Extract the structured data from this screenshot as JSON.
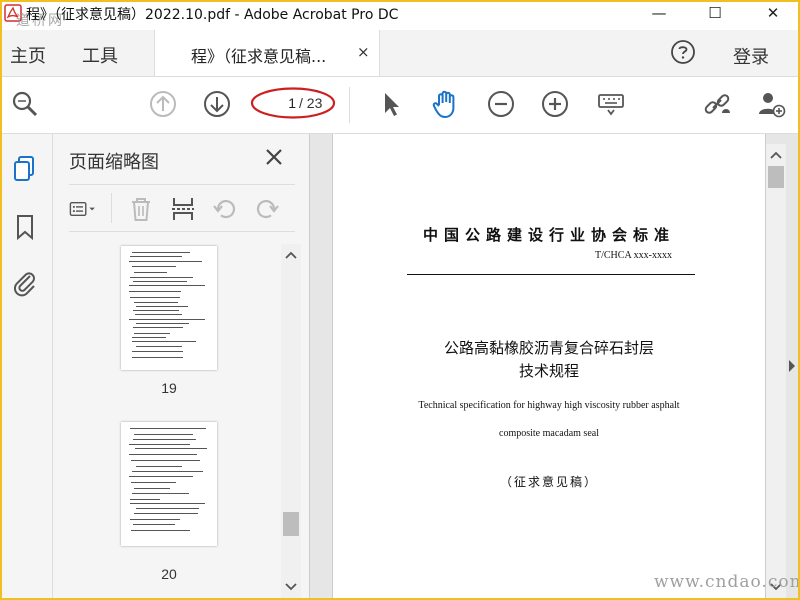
{
  "window": {
    "title": "程》（征求意见稿）2022.10.pdf - Adobe Acrobat Pro DC",
    "controls": {
      "minimize": "—",
      "maximize": "☐",
      "close": "✕"
    },
    "watermark_top": "道桥网",
    "watermark_bottom": "www.cndao.com"
  },
  "menu": {
    "home": "主页",
    "tools": "工具",
    "doc_tab_label": "程》（征求意见稿...",
    "doc_tab_close": "×",
    "login": "登录"
  },
  "toolbar": {
    "current_page": "1",
    "total_pages": "/ 23",
    "icons": [
      "search-zoom-icon",
      "page-up-icon",
      "page-down-icon",
      "select-arrow-icon",
      "hand-tool-icon",
      "zoom-out-icon",
      "zoom-in-icon",
      "keyboard-icon",
      "share-link-icon",
      "add-user-icon"
    ],
    "accent_color": "#1a73c8",
    "highlight_color": "#cc1f1f"
  },
  "thumbnails_panel": {
    "title": "页面缩略图",
    "thumbnails": [
      {
        "page": "19"
      },
      {
        "page": "20"
      }
    ]
  },
  "document": {
    "standard_title": "中国公路建设行业协会标准",
    "standard_code": "T/CHCA    xxx-xxxx",
    "cn_title_line1": "公路高黏橡胶沥青复合碎石封层",
    "cn_title_line2": "技术规程",
    "en_title_line1": "Technical specification for highway high viscosity rubber asphalt",
    "en_title_line2": "composite macadam seal",
    "draft_label": "（征求意见稿）"
  }
}
